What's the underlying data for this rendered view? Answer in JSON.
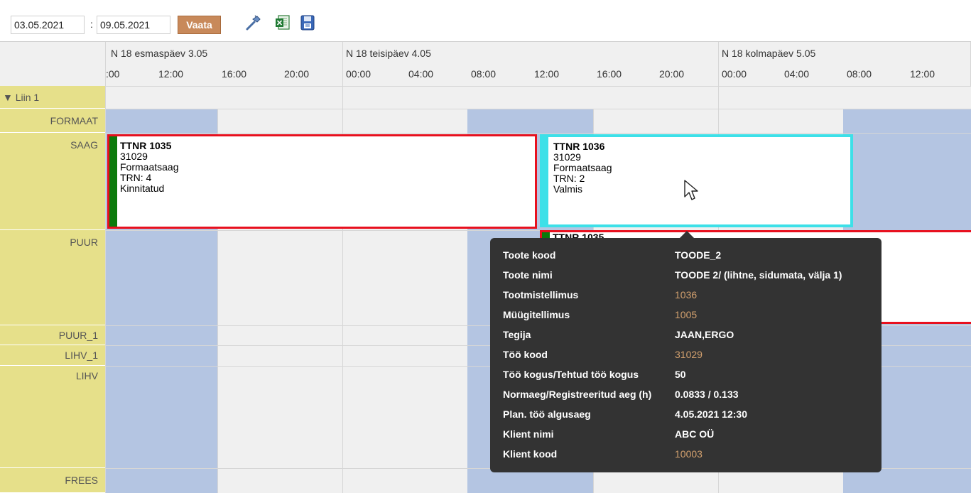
{
  "toolbar": {
    "date_from": "03.05.2021",
    "separator": ":",
    "date_to": "09.05.2021",
    "view_button": "Vaata",
    "icons": [
      "build-icon",
      "excel-export-icon",
      "save-icon"
    ]
  },
  "header": {
    "days": [
      {
        "label": "N 18 esmaspäev 3.05",
        "times": [
          ":00",
          "12:00",
          "16:00",
          "20:00"
        ]
      },
      {
        "label": "N 18 teisipäev 4.05",
        "times": [
          "00:00",
          "04:00",
          "08:00",
          "12:00",
          "16:00",
          "20:00"
        ]
      },
      {
        "label": "N 18 kolmapäev 5.05",
        "times": [
          "00:00",
          "04:00",
          "08:00",
          "12:00"
        ]
      }
    ]
  },
  "resources": {
    "group": "▼ Liin 1",
    "rows": [
      "FORMAAT",
      "SAAG",
      "PUUR",
      "PUUR_1",
      "LIHV_1",
      "LIHV",
      "FREES"
    ]
  },
  "tasks": [
    {
      "title": "TTNR 1035",
      "code": "31029",
      "op": "Formaatsaag",
      "trn": "TRN: 4",
      "status": "Kinnitatud",
      "border": "#e8101e"
    },
    {
      "title": "TTNR 1036",
      "code": "31029",
      "op": "Formaatsaag",
      "trn": "TRN: 2",
      "status": "Valmis",
      "border": "#3de0e8"
    },
    {
      "title": "TTNR 1035",
      "border": "#e8101e"
    }
  ],
  "tooltip": {
    "rows": [
      {
        "key": "Toote kood",
        "value": "TOODE_2",
        "link": false
      },
      {
        "key": "Toote nimi",
        "value": "TOODE 2/ (lihtne, sidumata, välja 1)",
        "link": false
      },
      {
        "key": "Tootmistellimus",
        "value": "1036",
        "link": true
      },
      {
        "key": "Müügitellimus",
        "value": "1005",
        "link": true
      },
      {
        "key": "Tegija",
        "value": "JAAN,ERGO",
        "link": false
      },
      {
        "key": "Töö kood",
        "value": "31029",
        "link": true
      },
      {
        "key": "Töö kogus/Tehtud töö kogus",
        "value": "50",
        "link": false
      },
      {
        "key": "Normaeg/Registreeritud aeg (h)",
        "value": "0.0833 / 0.133",
        "link": false
      },
      {
        "key": "Plan. töö algusaeg",
        "value": "4.05.2021 12:30",
        "link": false
      },
      {
        "key": "Klient nimi",
        "value": "ABC OÜ",
        "link": false
      },
      {
        "key": "Klient kood",
        "value": "10003",
        "link": true
      }
    ]
  },
  "colors": {
    "accent_button": "#c8895a",
    "resource_column": "#e6e08a",
    "lane_blue": "#b4c5e2",
    "task_green_bar": "#0b7a0b",
    "tooltip_bg": "#333333",
    "tooltip_link": "#d2a06e"
  }
}
